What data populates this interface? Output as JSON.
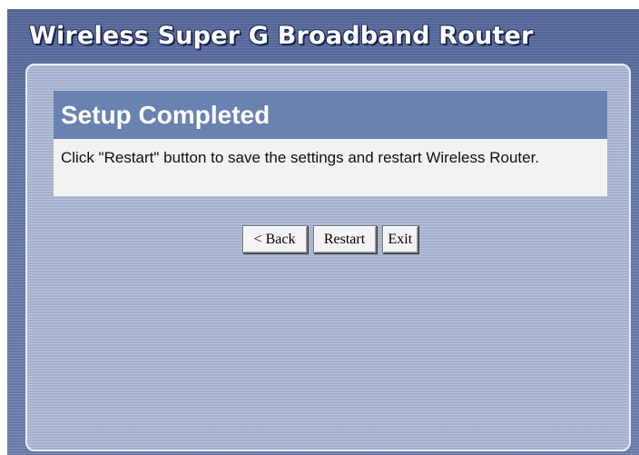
{
  "header": {
    "title": "Wireless Super G Broadband Router"
  },
  "page": {
    "heading": "Setup Completed",
    "message": "Click \"Restart\" button to save the settings and restart Wireless Router."
  },
  "buttons": {
    "back": "< Back",
    "restart": "Restart",
    "exit": "Exit"
  },
  "colors": {
    "frame_blue": "#6478a8",
    "panel_blue": "#aab6d2",
    "heading_blue": "#6a82b2",
    "message_bg": "#f2f2f2"
  }
}
